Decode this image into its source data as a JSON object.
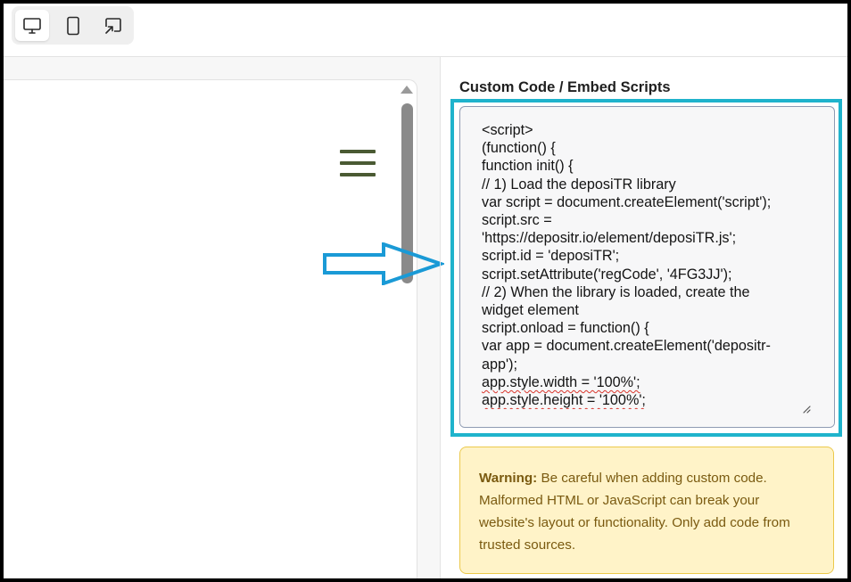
{
  "toolbar": {
    "devices": [
      {
        "name": "desktop",
        "icon": "desktop-icon",
        "active": true
      },
      {
        "name": "mobile",
        "icon": "mobile-icon",
        "active": false
      },
      {
        "name": "popout",
        "icon": "external-window-icon",
        "active": false
      }
    ]
  },
  "editor": {
    "label": "Custom Code / Embed Scripts",
    "code_lines": [
      "<script>",
      "(function() {",
      "function init() {",
      "// 1) Load the deposiTR library",
      "var script = document.createElement('script');",
      "script.src =",
      "'https://depositr.io/element/deposiTR.js';",
      "script.id = 'deposiTR';",
      "script.setAttribute('regCode', '4FG3JJ');",
      "// 2) When the library is loaded, create the",
      "widget element",
      "script.onload = function() {",
      "var app = document.createElement('depositr-",
      "app');",
      "app.style.width = '100%';",
      "app.style.height = '100%';"
    ]
  },
  "warning": {
    "title": "Warning:",
    "body": "Be careful when adding custom code. Malformed HTML or JavaScript can break your website's layout or functionality. Only add code from trusted sources."
  },
  "colors": {
    "highlight": "#1fb3cc",
    "arrow": "#1a9ad6",
    "hamburger": "#4a5a33",
    "warning_bg": "#fff3c8",
    "warning_border": "#ecc94b",
    "warning_text": "#7a5a10"
  }
}
